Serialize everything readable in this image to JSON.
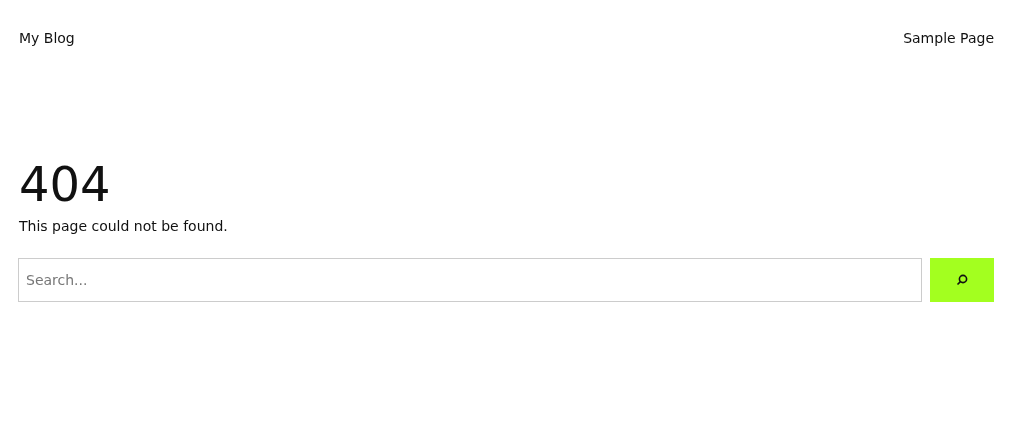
{
  "header": {
    "site_title": "My Blog",
    "nav": [
      {
        "label": "Sample Page"
      }
    ]
  },
  "error": {
    "code": "404",
    "message": "This page could not be found."
  },
  "search": {
    "placeholder": "Search..."
  }
}
